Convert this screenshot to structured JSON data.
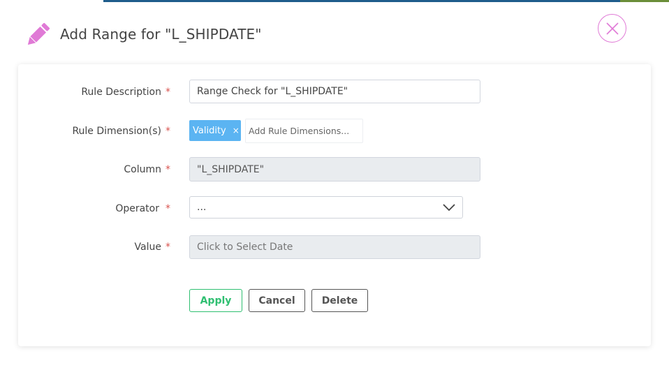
{
  "header": {
    "title": "Add Range for \"L_SHIPDATE\"",
    "icon": "pencil-icon",
    "accent_color": "#e07ad6"
  },
  "form": {
    "rule_description": {
      "label": "Rule Description",
      "required_mark": "*",
      "value": "Range Check for \"L_SHIPDATE\""
    },
    "rule_dimensions": {
      "label": "Rule Dimension(s)",
      "required_mark": "*",
      "tags": [
        "Validity"
      ],
      "tag_remove": "×",
      "placeholder": "Add Rule Dimensions..."
    },
    "column": {
      "label": "Column",
      "required_mark": "*",
      "value": "\"L_SHIPDATE\""
    },
    "operator": {
      "label": "Operator",
      "required_mark": "*",
      "selected": "..."
    },
    "value": {
      "label": "Value",
      "required_mark": "*",
      "placeholder": "Click to Select Date"
    }
  },
  "buttons": {
    "apply": "Apply",
    "cancel": "Cancel",
    "delete": "Delete"
  },
  "colors": {
    "tag_bg": "#5bb4f2",
    "apply": "#2fbf71",
    "required": "#d9534f"
  }
}
